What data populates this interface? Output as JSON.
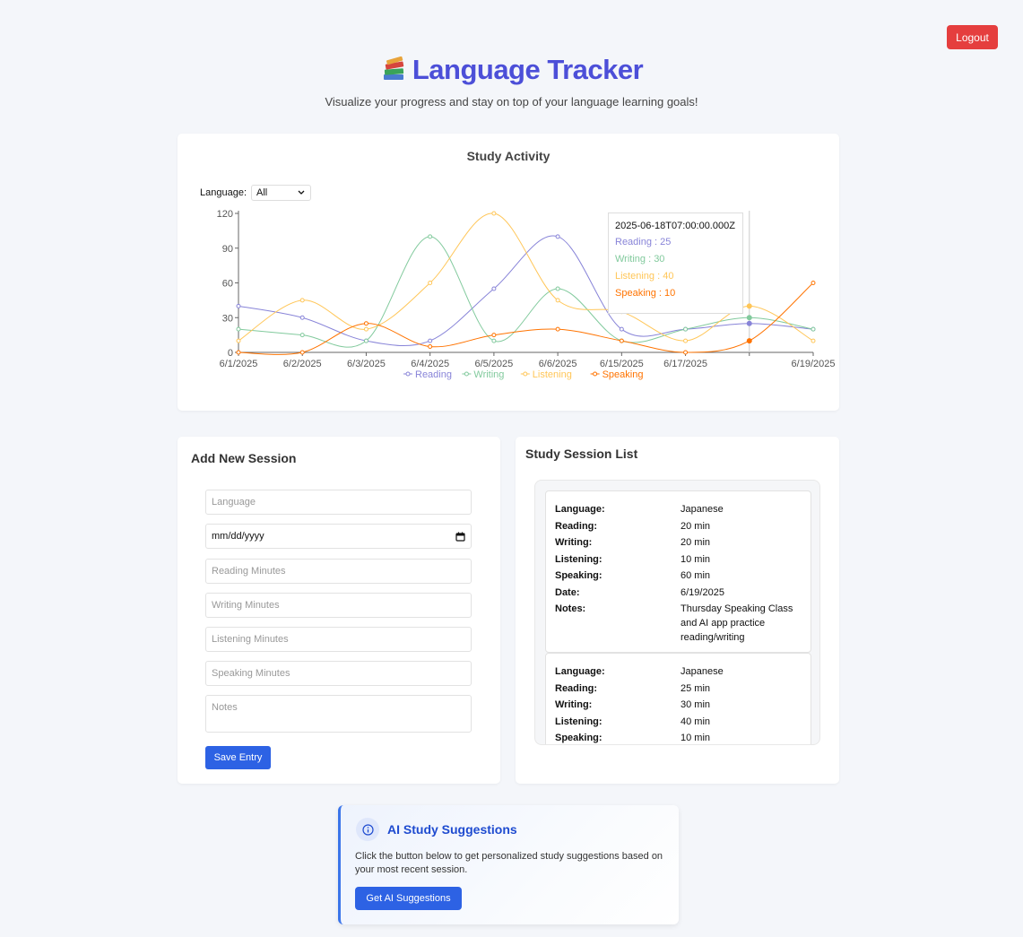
{
  "header": {
    "logout_label": "Logout",
    "title": "Language Tracker",
    "subtitle": "Visualize your progress and stay on top of your language learning goals!"
  },
  "chart": {
    "title": "Study Activity",
    "filter_label": "Language:",
    "filter_value": "All",
    "tooltip": {
      "date": "2025-06-18T07:00:00.000Z",
      "rows": [
        "Reading : 25",
        "Writing : 30",
        "Listening : 40",
        "Speaking : 10"
      ]
    }
  },
  "chart_data": {
    "type": "line",
    "x": [
      "6/1/2025",
      "6/2/2025",
      "6/3/2025",
      "6/4/2025",
      "6/5/2025",
      "6/6/2025",
      "6/15/2025",
      "6/17/2025",
      "6/18/2025",
      "6/19/2025"
    ],
    "x_tick_labels": [
      "6/1/2025",
      "6/2/2025",
      "6/3/2025",
      "6/4/2025",
      "6/5/2025",
      "6/6/2025",
      "6/15/2025",
      "6/17/2025",
      "",
      "6/19/2025"
    ],
    "y_ticks": [
      0,
      30,
      60,
      90,
      120
    ],
    "ylim": [
      0,
      120
    ],
    "legend_position": "bottom",
    "series": [
      {
        "name": "Reading",
        "color": "#8884d8",
        "values": [
          40,
          30,
          10,
          10,
          55,
          100,
          20,
          20,
          25,
          20
        ]
      },
      {
        "name": "Writing",
        "color": "#82ca9d",
        "values": [
          20,
          15,
          10,
          100,
          10,
          55,
          10,
          20,
          30,
          20
        ]
      },
      {
        "name": "Listening",
        "color": "#ffc658",
        "values": [
          10,
          45,
          20,
          60,
          120,
          45,
          35,
          10,
          40,
          10
        ]
      },
      {
        "name": "Speaking",
        "color": "#ff7300",
        "values": [
          0,
          0,
          25,
          5,
          15,
          20,
          10,
          0,
          10,
          60
        ]
      }
    ]
  },
  "form": {
    "title": "Add New Session",
    "language_placeholder": "Language",
    "date_value": "mm/dd/yyyy",
    "reading_placeholder": "Reading Minutes",
    "writing_placeholder": "Writing Minutes",
    "listening_placeholder": "Listening Minutes",
    "speaking_placeholder": "Speaking Minutes",
    "notes_placeholder": "Notes",
    "save_label": "Save Entry"
  },
  "sessions": {
    "title": "Study Session List",
    "entries": [
      {
        "rows": [
          {
            "k": "Language:",
            "v": "Japanese"
          },
          {
            "k": "Reading:",
            "v": "20 min"
          },
          {
            "k": "Writing:",
            "v": "20 min"
          },
          {
            "k": "Listening:",
            "v": "10 min"
          },
          {
            "k": "Speaking:",
            "v": "60 min"
          },
          {
            "k": "Date:",
            "v": "6/19/2025"
          },
          {
            "k": "Notes:",
            "v": "Thursday Speaking Class and AI app practice reading/writing"
          }
        ]
      },
      {
        "rows": [
          {
            "k": "Language:",
            "v": "Japanese"
          },
          {
            "k": "Reading:",
            "v": "25 min"
          },
          {
            "k": "Writing:",
            "v": "30 min"
          },
          {
            "k": "Listening:",
            "v": "40 min"
          },
          {
            "k": "Speaking:",
            "v": "10 min"
          }
        ]
      }
    ]
  },
  "ai": {
    "title": "AI Study Suggestions",
    "description": "Click the button below to get personalized study suggestions based on your most recent session.",
    "button_label": "Get AI Suggestions"
  }
}
